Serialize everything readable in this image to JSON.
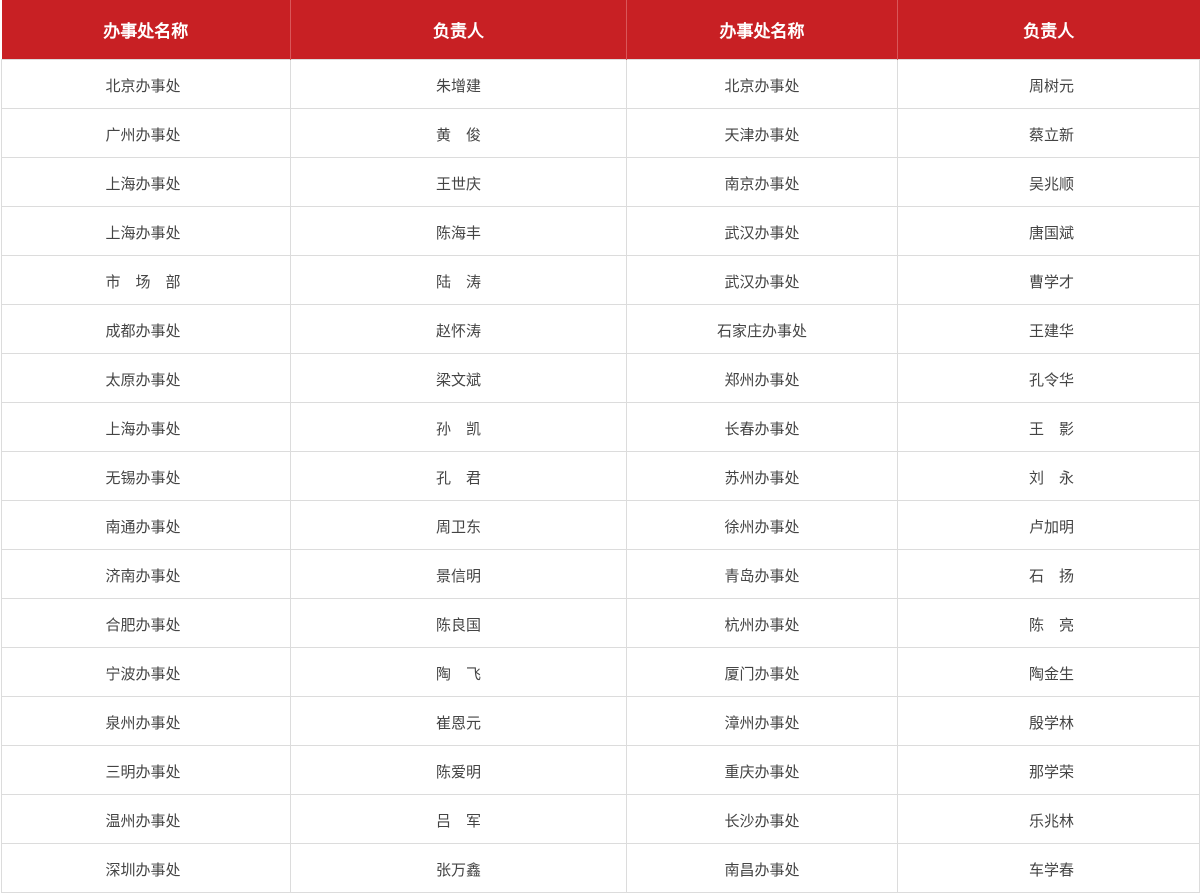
{
  "table": {
    "headers": [
      "办事处名称",
      "负责人",
      "办事处名称",
      "负责人"
    ],
    "rows": [
      [
        "北京办事处",
        "朱增建",
        "北京办事处",
        "周树元"
      ],
      [
        "广州办事处",
        "黄　俊",
        "天津办事处",
        "蔡立新"
      ],
      [
        "上海办事处",
        "王世庆",
        "南京办事处",
        "吴兆顺"
      ],
      [
        "上海办事处",
        "陈海丰",
        "武汉办事处",
        "唐国斌"
      ],
      [
        "市　场　部",
        "陆　涛",
        "武汉办事处",
        "曹学才"
      ],
      [
        "成都办事处",
        "赵怀涛",
        "石家庄办事处",
        "王建华"
      ],
      [
        "太原办事处",
        "梁文斌",
        "郑州办事处",
        "孔令华"
      ],
      [
        "上海办事处",
        "孙　凯",
        "长春办事处",
        "王　影"
      ],
      [
        "无锡办事处",
        "孔　君",
        "苏州办事处",
        "刘　永"
      ],
      [
        "南通办事处",
        "周卫东",
        "徐州办事处",
        "卢加明"
      ],
      [
        "济南办事处",
        "景信明",
        "青岛办事处",
        "石　扬"
      ],
      [
        "合肥办事处",
        "陈良国",
        "杭州办事处",
        "陈　亮"
      ],
      [
        "宁波办事处",
        "陶　飞",
        "厦门办事处",
        "陶金生"
      ],
      [
        "泉州办事处",
        "崔恩元",
        "漳州办事处",
        "殷学林"
      ],
      [
        "三明办事处",
        "陈爱明",
        "重庆办事处",
        "那学荣"
      ],
      [
        "温州办事处",
        "吕　军",
        "长沙办事处",
        "乐兆林"
      ],
      [
        "深圳办事处",
        "张万鑫",
        "南昌办事处",
        "车学春"
      ]
    ]
  },
  "colors": {
    "header_background": "#c82024",
    "header_text": "#ffffff",
    "cell_text": "#444444",
    "border": "#dcdcdc"
  }
}
